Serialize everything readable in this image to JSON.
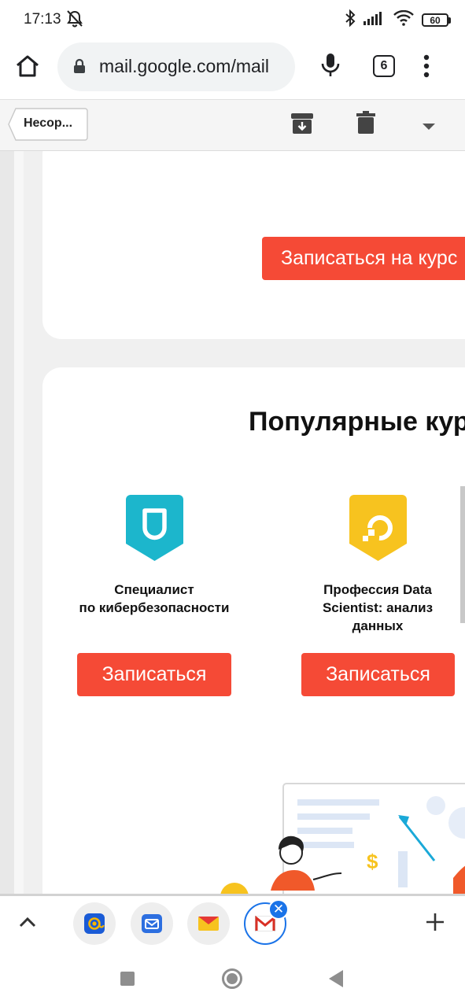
{
  "status_bar": {
    "time": "17:13",
    "battery": "60",
    "icons": [
      "notifications-muted-icon",
      "bluetooth-icon",
      "signal-icon",
      "wifi-icon",
      "battery-icon"
    ]
  },
  "browser": {
    "url": "mail.google.com/mail",
    "tab_count": "6",
    "icons": [
      "home-icon",
      "lock-icon",
      "mic-icon",
      "tabs-icon",
      "more-vert-icon"
    ]
  },
  "toolbar": {
    "back_label": "Несор...",
    "icons": [
      "archive-icon",
      "trash-icon",
      "dropdown-icon"
    ]
  },
  "email": {
    "enroll_course_label": "Записаться на курс",
    "section_title": "Популярные курсы",
    "courses": [
      {
        "title_line1": "Специалист",
        "title_line2": "по кибербезопасности",
        "title_line3": "",
        "button_label": "Записаться",
        "icon": "shield-d-icon",
        "icon_color": "#1cb6cc"
      },
      {
        "title_line1": "Профессия Data",
        "title_line2": "Scientist: анализ",
        "title_line3": "данных",
        "button_label": "Записаться",
        "icon": "data-scientist-icon",
        "icon_color": "#f7c31f"
      }
    ],
    "accent_color": "#f54a36",
    "illustration_dollar": "$"
  },
  "app_bar": {
    "apps": [
      "mail-ru-icon",
      "mail-app-icon",
      "yandex-mail-icon",
      "gmail-icon"
    ],
    "close_label": "✕"
  }
}
